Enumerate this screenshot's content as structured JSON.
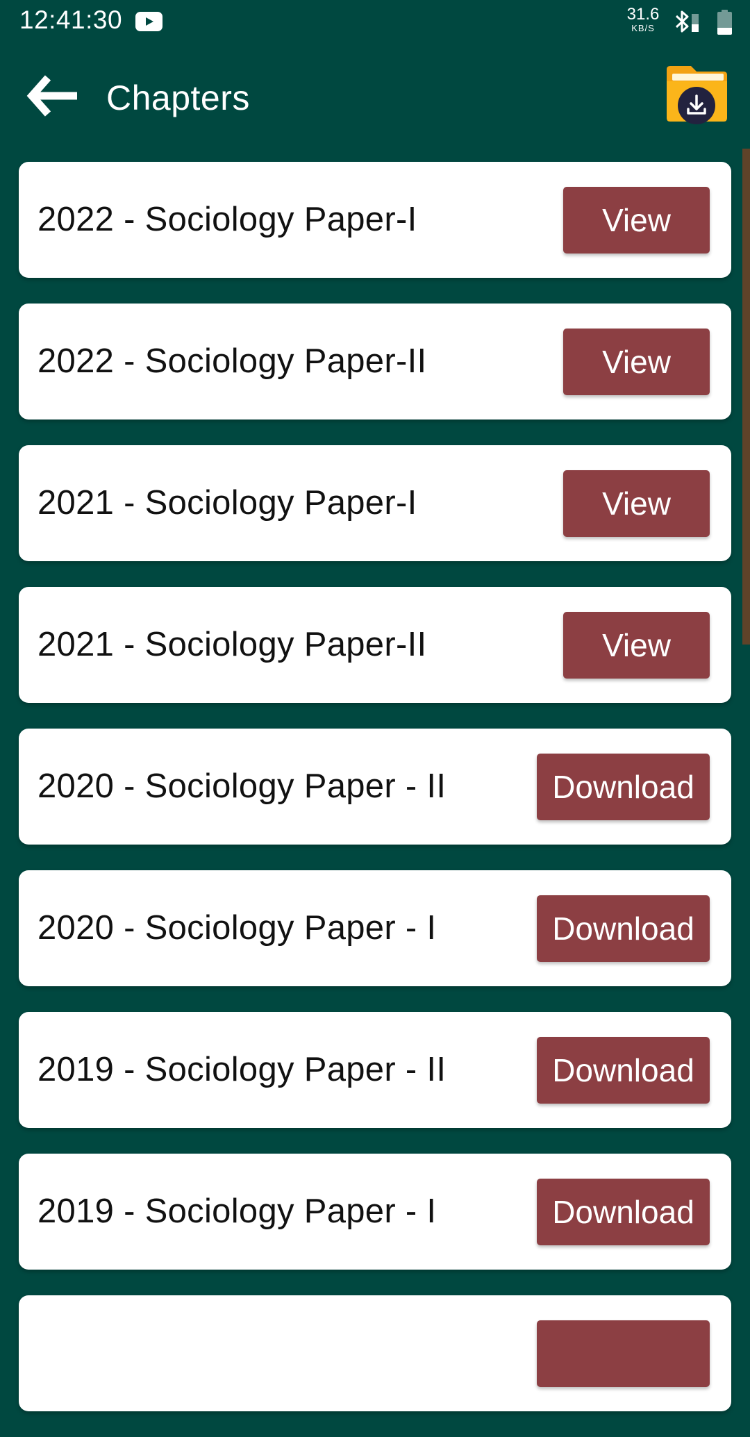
{
  "status_bar": {
    "time": "12:41:30",
    "notification_icons": [
      "youtube-icon"
    ],
    "network_speed_value": "31.6",
    "network_speed_unit": "KB/S",
    "bluetooth": "bluetooth-icon",
    "signal": "signal-icon",
    "battery_level_fraction": 0.3
  },
  "app_bar": {
    "back_icon": "arrow-left-icon",
    "title": "Chapters",
    "action_icon": "folder-download-icon"
  },
  "theme": {
    "background": "#004840",
    "card": "#ffffff",
    "button": "#8c3f43",
    "button_text": "#ffffff",
    "scrollbar": "#5f4329",
    "folder": "#fbb51a",
    "folder_badge": "#22223f"
  },
  "chapters": [
    {
      "title": "2022 - Sociology Paper-I",
      "action": "View",
      "type": "view"
    },
    {
      "title": "2022 - Sociology Paper-II",
      "action": "View",
      "type": "view"
    },
    {
      "title": "2021 - Sociology Paper-I",
      "action": "View",
      "type": "view"
    },
    {
      "title": "2021 - Sociology Paper-II",
      "action": "View",
      "type": "view"
    },
    {
      "title": "2020 - Sociology Paper - II",
      "action": "Download",
      "type": "download"
    },
    {
      "title": "2020 - Sociology Paper - I",
      "action": "Download",
      "type": "download"
    },
    {
      "title": "2019 - Sociology Paper - II",
      "action": "Download",
      "type": "download"
    },
    {
      "title": "2019 - Sociology Paper - I",
      "action": "Download",
      "type": "download"
    },
    {
      "title": "",
      "action": "",
      "type": "download"
    }
  ]
}
